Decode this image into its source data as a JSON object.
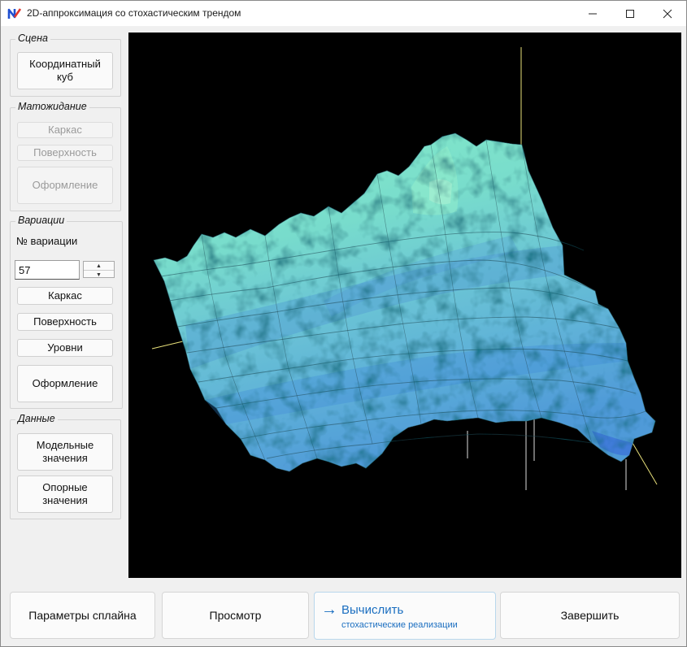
{
  "window": {
    "title": "2D-аппроксимация со стохастическим трендом"
  },
  "scene": {
    "legend": "Сцена",
    "coord_cube": "Координатный\nкуб"
  },
  "expectation": {
    "legend": "Матожидание",
    "frame": "Каркас",
    "surface": "Поверхность",
    "style": "Оформление"
  },
  "variations": {
    "legend": "Вариации",
    "number_label": "№ вариации",
    "number_value": "57",
    "frame": "Каркас",
    "surface": "Поверхность",
    "levels": "Уровни",
    "style": "Оформление"
  },
  "data_group": {
    "legend": "Данные",
    "model_values": "Модельные\nзначения",
    "reference_values": "Опорные\nзначения"
  },
  "bottom": {
    "spline_params": "Параметры сплайна",
    "preview": "Просмотр",
    "compute_main": "Вычислить",
    "compute_sub": "стохастические реализации",
    "finish": "Завершить"
  },
  "colors": {
    "accent": "#1a6ec0",
    "surface_light": "#7fe3c6",
    "surface_mid": "#6fc9d2",
    "surface_dark": "#3c86d6",
    "viewport_bg": "#000000"
  },
  "icons": {
    "app": "app-logo-icon",
    "minimize": "minimize-icon",
    "maximize": "maximize-icon",
    "close": "close-icon",
    "compute": "arrow-right-icon"
  }
}
